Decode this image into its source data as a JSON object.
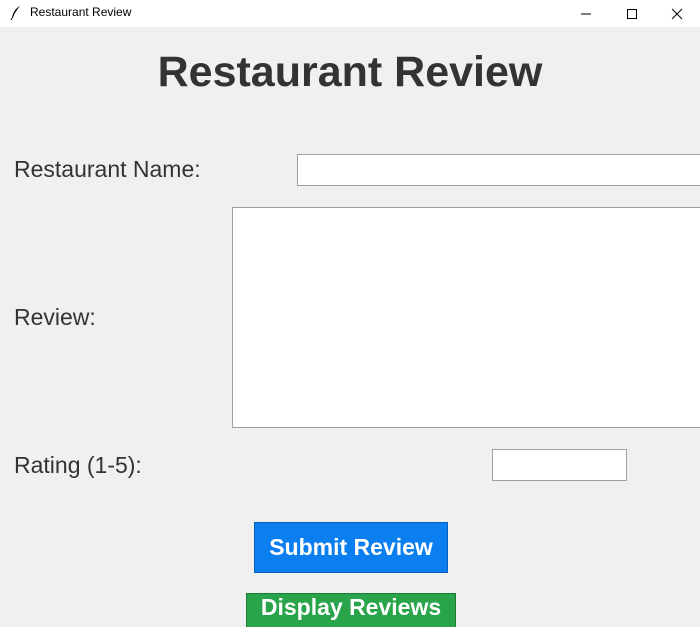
{
  "window": {
    "title": "Restaurant Review",
    "icon": "feather-icon"
  },
  "titlebar_controls": {
    "minimize": "minimize-icon",
    "maximize": "maximize-icon",
    "close": "close-icon"
  },
  "form": {
    "heading": "Restaurant Review",
    "restaurant_name_label": "Restaurant Name:",
    "restaurant_name_value": "",
    "review_label": "Review:",
    "review_value": "",
    "rating_label": "Rating (1-5):",
    "rating_value": ""
  },
  "buttons": {
    "submit_label": "Submit Review",
    "submit_color": "#0b7ff0",
    "display_label": "Display Reviews",
    "display_color": "#2aa44a"
  }
}
